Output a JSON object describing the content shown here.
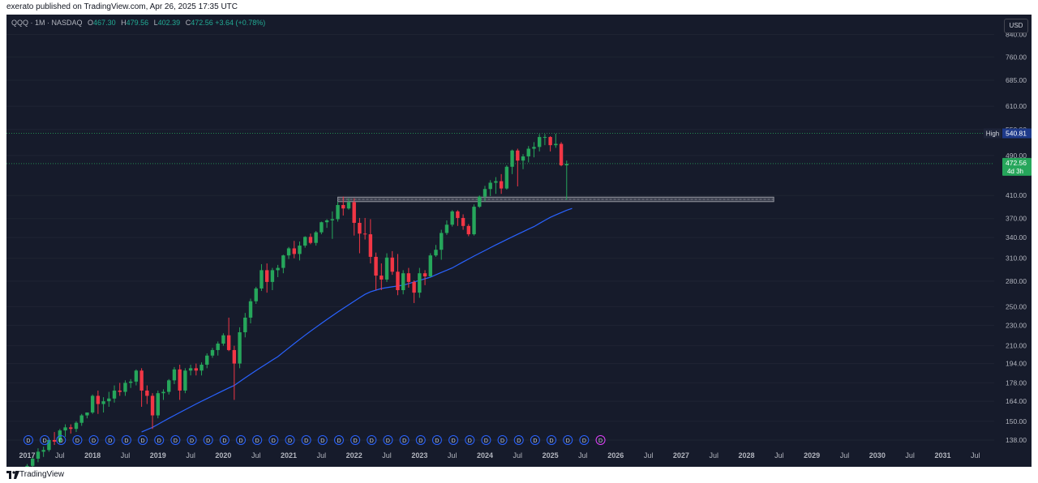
{
  "header": {
    "publisher_text": "exerato published on TradingView.com, Apr 26, 2025 17:35 UTC"
  },
  "legend": {
    "symbol": "QQQ · 1M · NASDAQ",
    "open_label": "O",
    "open": "467.30",
    "high_label": "H",
    "high": "479.56",
    "low_label": "L",
    "low": "402.39",
    "close_label": "C",
    "close": "472.56",
    "change": "+3.64 (+0.78%)"
  },
  "currency_button": "USD",
  "footer": {
    "brand": "TradingView"
  },
  "colors": {
    "background": "#161b2b",
    "up": "#26a65b",
    "down": "#f23645",
    "ma": "#2962ff",
    "dividend": "#2962ff",
    "grid": "#1f2433"
  },
  "chart_data": {
    "type": "candlestick",
    "scale": "log",
    "ylim": [
      136,
      860
    ],
    "y_ticks": [
      "840.00",
      "760.00",
      "685.00",
      "610.00",
      "550.00",
      "490.00",
      "410.00",
      "370.00",
      "340.00",
      "310.00",
      "280.00",
      "250.00",
      "230.00",
      "210.00",
      "194.00",
      "178.00",
      "164.00",
      "150.00",
      "138.00"
    ],
    "x_ticks": [
      "2017",
      "Jul",
      "2018",
      "Jul",
      "2019",
      "Jul",
      "2020",
      "Jul",
      "2021",
      "Jul",
      "2022",
      "Jul",
      "2023",
      "Jul",
      "2024",
      "Jul",
      "2025",
      "Jul",
      "2026",
      "Jul",
      "2027",
      "Jul",
      "2028",
      "Jul",
      "2029",
      "Jul",
      "2030",
      "Jul",
      "2031",
      "Jul"
    ],
    "x_start": "2017-01",
    "ohlc": [
      [
        120,
        124,
        118,
        123
      ],
      [
        123,
        128,
        122,
        127
      ],
      [
        127,
        133,
        125,
        131
      ],
      [
        131,
        134,
        128,
        132
      ],
      [
        132,
        139,
        131,
        138
      ],
      [
        138,
        143,
        135,
        137
      ],
      [
        137,
        145,
        136,
        144
      ],
      [
        144,
        148,
        140,
        146
      ],
      [
        146,
        148,
        142,
        145
      ],
      [
        145,
        150,
        143,
        149
      ],
      [
        149,
        155,
        147,
        154
      ],
      [
        154,
        156,
        152,
        156
      ],
      [
        156,
        169,
        155,
        168
      ],
      [
        168,
        172,
        155,
        162
      ],
      [
        162,
        167,
        156,
        164
      ],
      [
        164,
        171,
        160,
        166
      ],
      [
        166,
        176,
        163,
        172
      ],
      [
        172,
        178,
        168,
        171
      ],
      [
        171,
        180,
        168,
        178
      ],
      [
        178,
        181,
        174,
        179
      ],
      [
        179,
        189,
        176,
        188
      ],
      [
        188,
        190,
        160,
        172
      ],
      [
        172,
        176,
        162,
        168
      ],
      [
        168,
        170,
        145,
        154
      ],
      [
        154,
        172,
        152,
        170
      ],
      [
        170,
        173,
        165,
        171
      ],
      [
        171,
        181,
        169,
        180
      ],
      [
        180,
        191,
        177,
        189
      ],
      [
        189,
        193,
        165,
        172
      ],
      [
        172,
        190,
        170,
        188
      ],
      [
        188,
        193,
        184,
        190
      ],
      [
        190,
        194,
        184,
        188
      ],
      [
        188,
        195,
        184,
        193
      ],
      [
        193,
        203,
        190,
        201
      ],
      [
        201,
        208,
        199,
        206
      ],
      [
        206,
        214,
        201,
        212
      ],
      [
        212,
        222,
        210,
        220
      ],
      [
        220,
        238,
        205,
        206
      ],
      [
        206,
        210,
        165,
        194
      ],
      [
        194,
        228,
        190,
        223
      ],
      [
        223,
        243,
        218,
        238
      ],
      [
        238,
        259,
        232,
        256
      ],
      [
        256,
        273,
        253,
        271
      ],
      [
        271,
        302,
        268,
        294
      ],
      [
        294,
        303,
        266,
        279
      ],
      [
        279,
        297,
        269,
        294
      ],
      [
        294,
        301,
        285,
        297
      ],
      [
        297,
        315,
        290,
        314
      ],
      [
        314,
        326,
        309,
        324
      ],
      [
        324,
        335,
        310,
        316
      ],
      [
        316,
        334,
        307,
        328
      ],
      [
        328,
        342,
        325,
        341
      ],
      [
        341,
        346,
        330,
        332
      ],
      [
        332,
        350,
        328,
        348
      ],
      [
        348,
        365,
        345,
        364
      ],
      [
        364,
        369,
        355,
        367
      ],
      [
        367,
        382,
        338,
        369
      ],
      [
        369,
        399,
        365,
        393
      ],
      [
        393,
        408,
        375,
        387
      ],
      [
        387,
        405,
        385,
        398
      ],
      [
        398,
        405,
        343,
        363
      ],
      [
        363,
        371,
        317,
        346
      ],
      [
        346,
        371,
        337,
        345
      ],
      [
        345,
        369,
        303,
        312
      ],
      [
        312,
        318,
        269,
        287
      ],
      [
        287,
        303,
        269,
        282
      ],
      [
        282,
        317,
        279,
        311
      ],
      [
        311,
        320,
        288,
        292
      ],
      [
        292,
        316,
        263,
        269
      ],
      [
        269,
        294,
        264,
        290
      ],
      [
        290,
        297,
        272,
        279
      ],
      [
        279,
        281,
        254,
        266
      ],
      [
        266,
        297,
        260,
        290
      ],
      [
        290,
        294,
        275,
        286
      ],
      [
        286,
        317,
        285,
        314
      ],
      [
        314,
        329,
        312,
        322
      ],
      [
        322,
        352,
        308,
        347
      ],
      [
        347,
        367,
        344,
        360
      ],
      [
        360,
        384,
        357,
        382
      ],
      [
        382,
        384,
        358,
        371
      ],
      [
        371,
        377,
        352,
        358
      ],
      [
        358,
        361,
        342,
        345
      ],
      [
        345,
        394,
        343,
        390
      ],
      [
        390,
        410,
        388,
        408
      ],
      [
        408,
        428,
        399,
        422
      ],
      [
        422,
        439,
        409,
        434
      ],
      [
        434,
        445,
        413,
        437
      ],
      [
        437,
        451,
        413,
        423
      ],
      [
        423,
        469,
        421,
        466
      ],
      [
        466,
        503,
        451,
        501
      ],
      [
        501,
        505,
        427,
        479
      ],
      [
        479,
        493,
        461,
        488
      ],
      [
        488,
        511,
        475,
        505
      ],
      [
        505,
        520,
        486,
        509
      ],
      [
        509,
        539,
        499,
        532
      ],
      [
        532,
        539,
        513,
        532
      ],
      [
        532,
        534,
        499,
        513
      ],
      [
        513,
        540,
        507,
        516
      ],
      [
        516,
        520,
        467,
        469
      ],
      [
        469,
        479,
        402,
        472
      ]
    ],
    "ma_x_start": "2018-10",
    "ma": [
      143,
      144.5,
      146,
      148,
      150,
      152,
      154,
      156,
      158,
      160,
      162,
      164,
      166,
      168,
      170,
      172,
      174,
      176,
      179,
      182,
      185,
      188,
      191,
      194,
      197,
      200,
      204,
      208,
      212,
      216,
      220,
      224,
      228,
      232,
      236,
      240,
      244,
      248,
      252,
      256,
      260,
      264,
      267,
      269,
      271,
      272,
      273,
      274,
      275,
      277,
      279,
      281,
      283,
      285,
      288,
      291,
      294,
      297,
      301,
      305,
      309,
      313,
      317,
      321,
      325,
      329,
      333,
      337,
      341,
      345,
      349,
      353,
      357,
      362,
      367,
      372,
      376,
      380,
      384,
      387
    ],
    "resistance": {
      "low": 399,
      "high": 407,
      "x_from": "2021-10",
      "x_to": "2028-06"
    },
    "high_line": {
      "label": "High",
      "value": "540.81"
    },
    "last_price": {
      "value": "472.56",
      "countdown": "4d 3h"
    },
    "dividends": {
      "marker": "D",
      "x_from": "2017-03",
      "count": 36
    }
  }
}
